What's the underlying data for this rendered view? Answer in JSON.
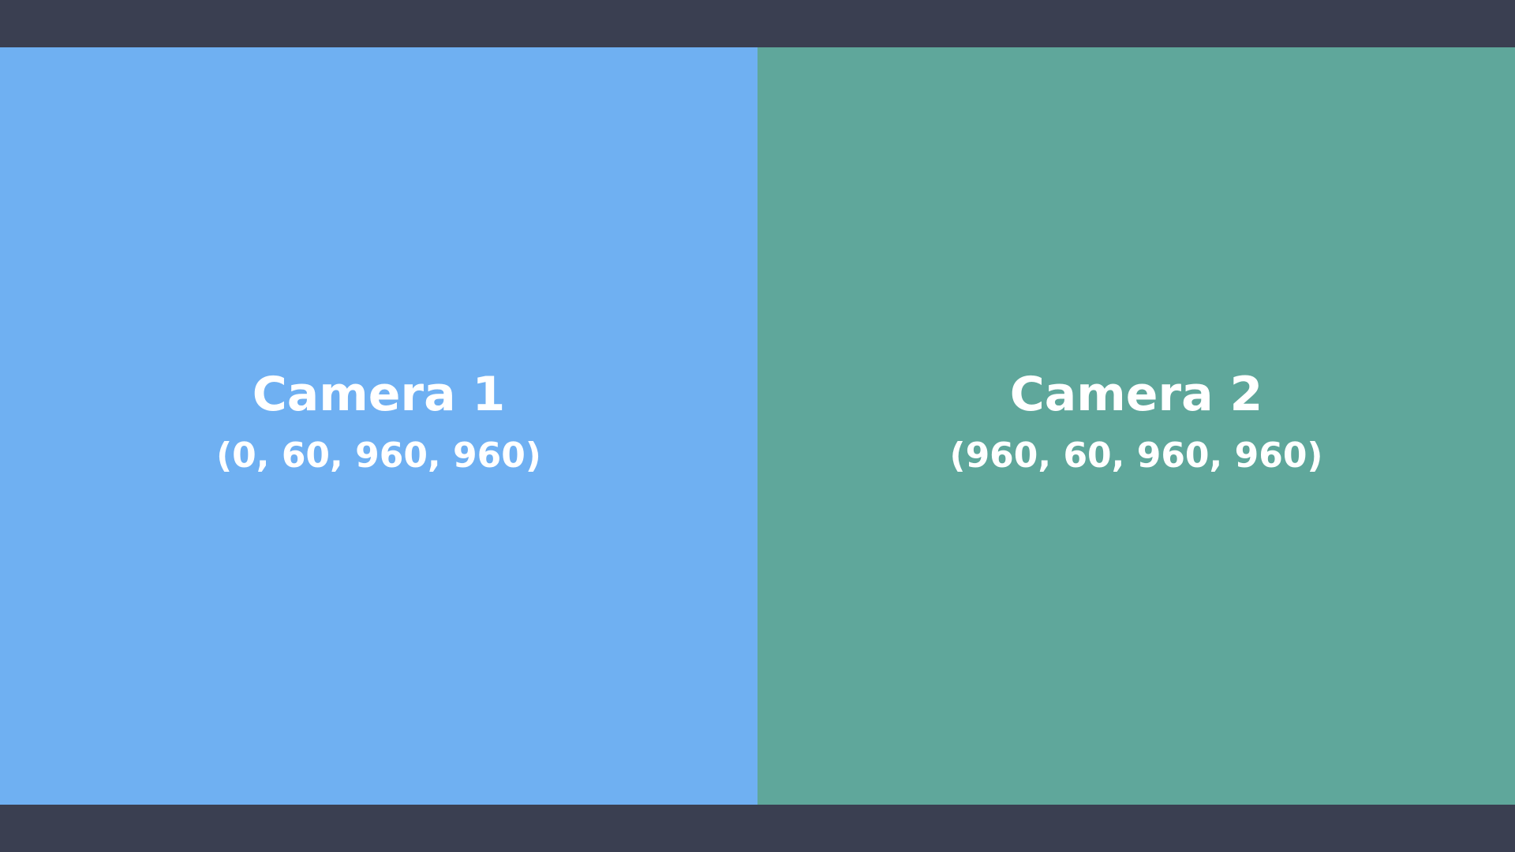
{
  "colors": {
    "frame": "#3a3f51",
    "camera1_bg": "#6fb0f2",
    "camera2_bg": "#5fa79b",
    "text": "#ffffff"
  },
  "cameras": [
    {
      "title": "Camera 1",
      "coords": "(0, 60, 960, 960)"
    },
    {
      "title": "Camera 2",
      "coords": "(960, 60, 960, 960)"
    }
  ]
}
